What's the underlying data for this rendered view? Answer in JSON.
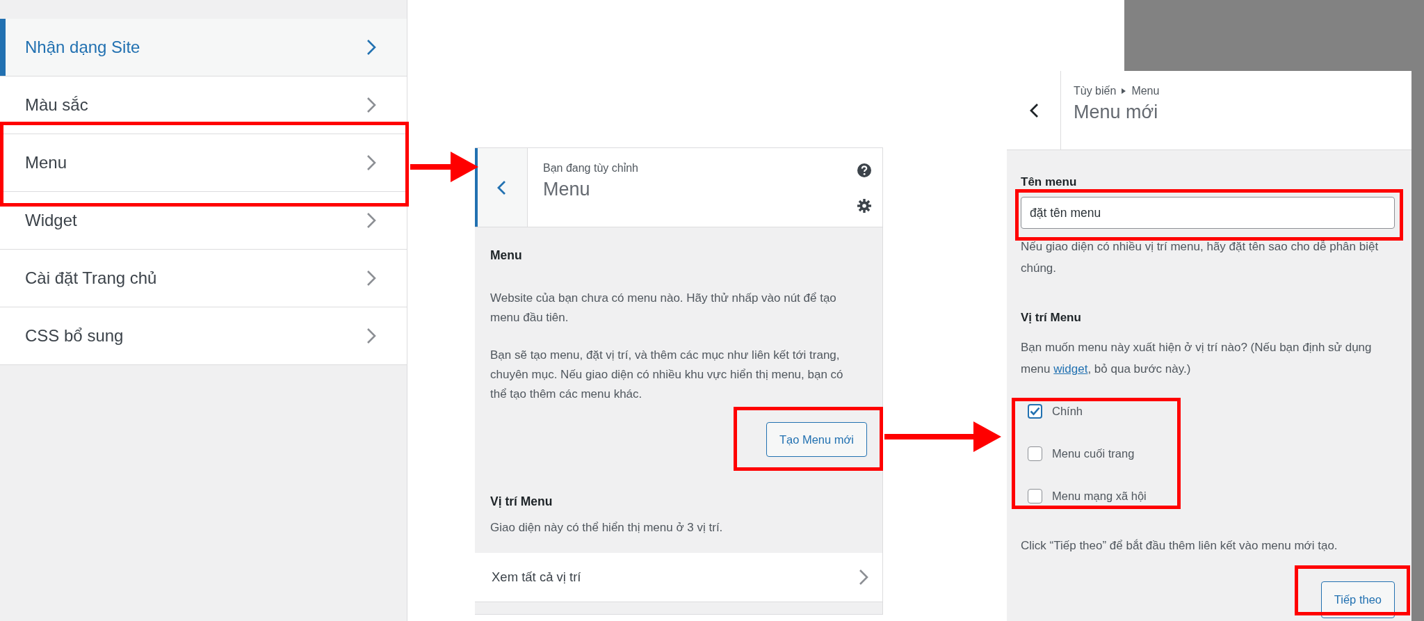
{
  "sections_panel": {
    "items": [
      {
        "label": "Nhận dạng Site",
        "selected": true
      },
      {
        "label": "Màu sắc",
        "selected": false
      },
      {
        "label": "Menu",
        "selected": false
      },
      {
        "label": "Widget",
        "selected": false
      },
      {
        "label": "Cài đặt Trang chủ",
        "selected": false
      },
      {
        "label": "CSS bổ sung",
        "selected": false
      }
    ]
  },
  "menus_panel": {
    "breadcrumb": "Bạn đang tùy chỉnh",
    "title": "Menu",
    "section_title": "Menu",
    "paragraphs": [
      "Website của bạn chưa có menu nào. Hãy thử nhấp vào nút để tạo menu đầu tiên.",
      "Bạn sẽ tạo menu, đặt vị trí, và thêm các mục như liên kết tới trang, chuyên mục. Nếu giao diện có nhiều khu vực hiển thị menu, bạn có thể tạo thêm các menu khác."
    ],
    "create_button": "Tạo Menu mới",
    "locations_title": "Vị trí Menu",
    "locations_note": "Giao diện này có thể hiển thị menu ở 3 vị trí.",
    "view_all": "Xem tất cả vị trí"
  },
  "new_menu_panel": {
    "breadcrumb": [
      "Tùy biến",
      "Menu"
    ],
    "title": "Menu mới",
    "name_label": "Tên menu",
    "name_value": "đặt tên menu",
    "name_hint": "Nếu giao diện có nhiều vị trí menu, hãy đặt tên sao cho dễ phân biệt chúng.",
    "locations_title": "Vị trí Menu",
    "locations_question": {
      "before": "Bạn muốn menu này xuất hiện ở vị trí nào? (Nếu bạn định sử dụng menu ",
      "link": "widget",
      "after": ", bỏ qua bước này.)"
    },
    "locations": [
      {
        "label": "Chính",
        "checked": true
      },
      {
        "label": "Menu cuối trang",
        "checked": false
      },
      {
        "label": "Menu mạng xã hội",
        "checked": false
      }
    ],
    "next_hint": "Click “Tiếp theo” để bắt đầu thêm liên kết vào menu mới tạo.",
    "next_button": "Tiếp theo"
  }
}
